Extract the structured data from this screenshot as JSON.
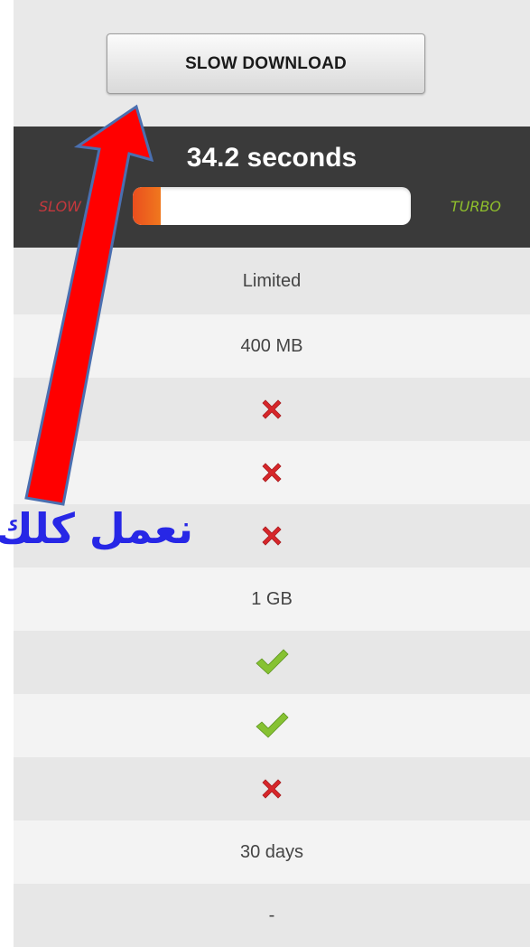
{
  "download_button": {
    "label": "SLOW DOWNLOAD"
  },
  "speed": {
    "time": "34.2 seconds",
    "slow_label": "SLOW",
    "turbo_label": "TURBO",
    "level": 0.1
  },
  "rows": [
    {
      "type": "text",
      "value": "Limited"
    },
    {
      "type": "text",
      "value": "400 MB"
    },
    {
      "type": "cross",
      "icon": "cross-icon"
    },
    {
      "type": "cross",
      "icon": "cross-icon"
    },
    {
      "type": "cross",
      "icon": "cross-icon"
    },
    {
      "type": "text",
      "value": "1 GB"
    },
    {
      "type": "check",
      "icon": "check-icon"
    },
    {
      "type": "check",
      "icon": "check-icon"
    },
    {
      "type": "cross",
      "icon": "cross-icon"
    },
    {
      "type": "text",
      "value": "30 days"
    },
    {
      "type": "text",
      "value": "-"
    }
  ],
  "annotation": {
    "text": "نعمل كلك"
  },
  "colors": {
    "cross": "#d7262a",
    "check": "#86c232",
    "arrow_fill": "#ff0000",
    "arrow_outline": "#4a6fb0",
    "annotation": "#2727e6"
  }
}
